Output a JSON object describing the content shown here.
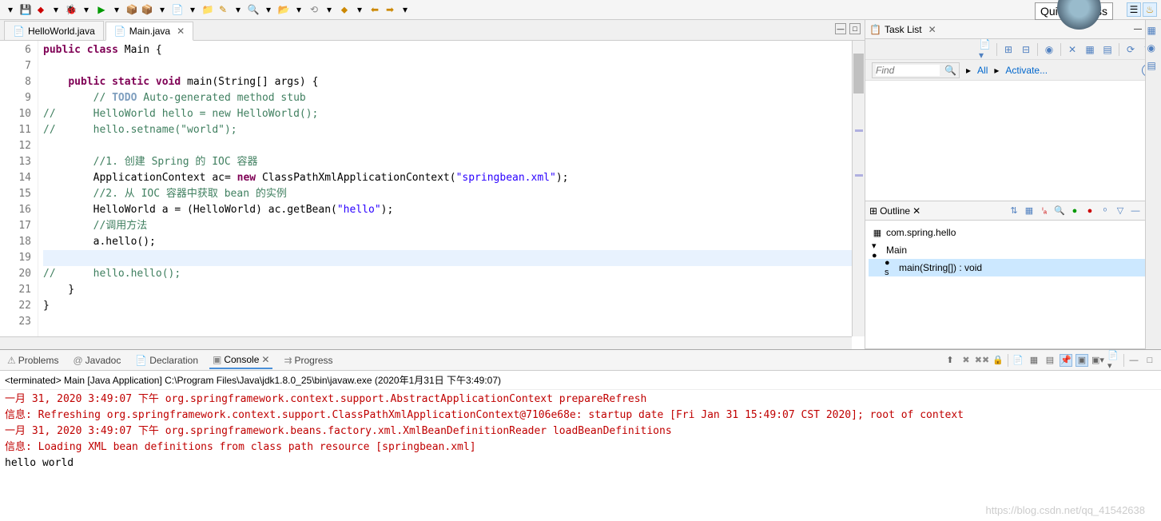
{
  "quick_access": "Quick Access",
  "editor": {
    "tabs": [
      {
        "label": "HelloWorld.java",
        "active": false
      },
      {
        "label": "Main.java",
        "active": true
      }
    ],
    "lines": [
      {
        "n": 6,
        "html": "<span class='kw'>public</span> <span class='kw'>class</span> Main {"
      },
      {
        "n": 7,
        "html": ""
      },
      {
        "n": 8,
        "html": "    <span class='kw'>public</span> <span class='kw'>static</span> <span class='kw'>void</span> main(String[] args) {",
        "mark": "▶"
      },
      {
        "n": 9,
        "html": "        <span class='cm'>//</span> <span class='todo'>TODO</span> <span class='cm'>Auto-generated method stub</span>"
      },
      {
        "n": 10,
        "html": "<span class='cm'>//      HelloWorld hello = new HelloWorld();</span>"
      },
      {
        "n": 11,
        "html": "<span class='cm'>//      hello.setname(\"world\");</span>"
      },
      {
        "n": 12,
        "html": ""
      },
      {
        "n": 13,
        "html": "        <span class='cm'>//1. 创建 Spring 的 IOC 容器</span>"
      },
      {
        "n": 14,
        "html": "        ApplicationContext ac= <span class='kw'>new</span> ClassPathXmlApplicationContext(<span class='str'>\"springbean.xml\"</span>);",
        "mark": "⚠"
      },
      {
        "n": 15,
        "html": "        <span class='cm'>//2. 从 IOC 容器中获取 bean 的实例</span>"
      },
      {
        "n": 16,
        "html": "        HelloWorld a = (HelloWorld) ac.getBean(<span class='str'>\"hello\"</span>);"
      },
      {
        "n": 17,
        "html": "        <span class='cm'>//调用方法</span>"
      },
      {
        "n": 18,
        "html": "        a.hello();"
      },
      {
        "n": 19,
        "html": "        ",
        "hl": true
      },
      {
        "n": 20,
        "html": "<span class='cm'>//      hello.hello();</span>"
      },
      {
        "n": 21,
        "html": "    }"
      },
      {
        "n": 22,
        "html": "}"
      },
      {
        "n": 23,
        "html": ""
      }
    ]
  },
  "tasklist": {
    "title": "Task List",
    "find_placeholder": "Find",
    "all": "All",
    "activate": "Activate..."
  },
  "outline": {
    "title": "Outline",
    "items": [
      {
        "icon": "▦",
        "label": "com.spring.hello",
        "indent": 0
      },
      {
        "icon": "▾ ●",
        "label": "Main",
        "indent": 0
      },
      {
        "icon": "● s",
        "label": "main(String[]) : void",
        "indent": 1,
        "sel": true
      }
    ]
  },
  "bottom_tabs": [
    {
      "icon": "⚠",
      "label": "Problems"
    },
    {
      "icon": "@",
      "label": "Javadoc"
    },
    {
      "icon": "📄",
      "label": "Declaration"
    },
    {
      "icon": "▣",
      "label": "Console",
      "active": true
    },
    {
      "icon": "⇉",
      "label": "Progress"
    }
  ],
  "terminated": "<terminated> Main [Java Application] C:\\Program Files\\Java\\jdk1.8.0_25\\bin\\javaw.exe (2020年1月31日 下午3:49:07)",
  "console_lines": [
    {
      "cls": "red",
      "text": "一月 31, 2020 3:49:07 下午 org.springframework.context.support.AbstractApplicationContext prepareRefresh"
    },
    {
      "cls": "red",
      "text": "信息: Refreshing org.springframework.context.support.ClassPathXmlApplicationContext@7106e68e: startup date [Fri Jan 31 15:49:07 CST 2020]; root of context"
    },
    {
      "cls": "red",
      "text": "一月 31, 2020 3:49:07 下午 org.springframework.beans.factory.xml.XmlBeanDefinitionReader loadBeanDefinitions"
    },
    {
      "cls": "red",
      "text": "信息: Loading XML bean definitions from class path resource [springbean.xml]"
    },
    {
      "cls": "",
      "text": "hello world"
    }
  ],
  "watermark": "https://blog.csdn.net/qq_41542638"
}
